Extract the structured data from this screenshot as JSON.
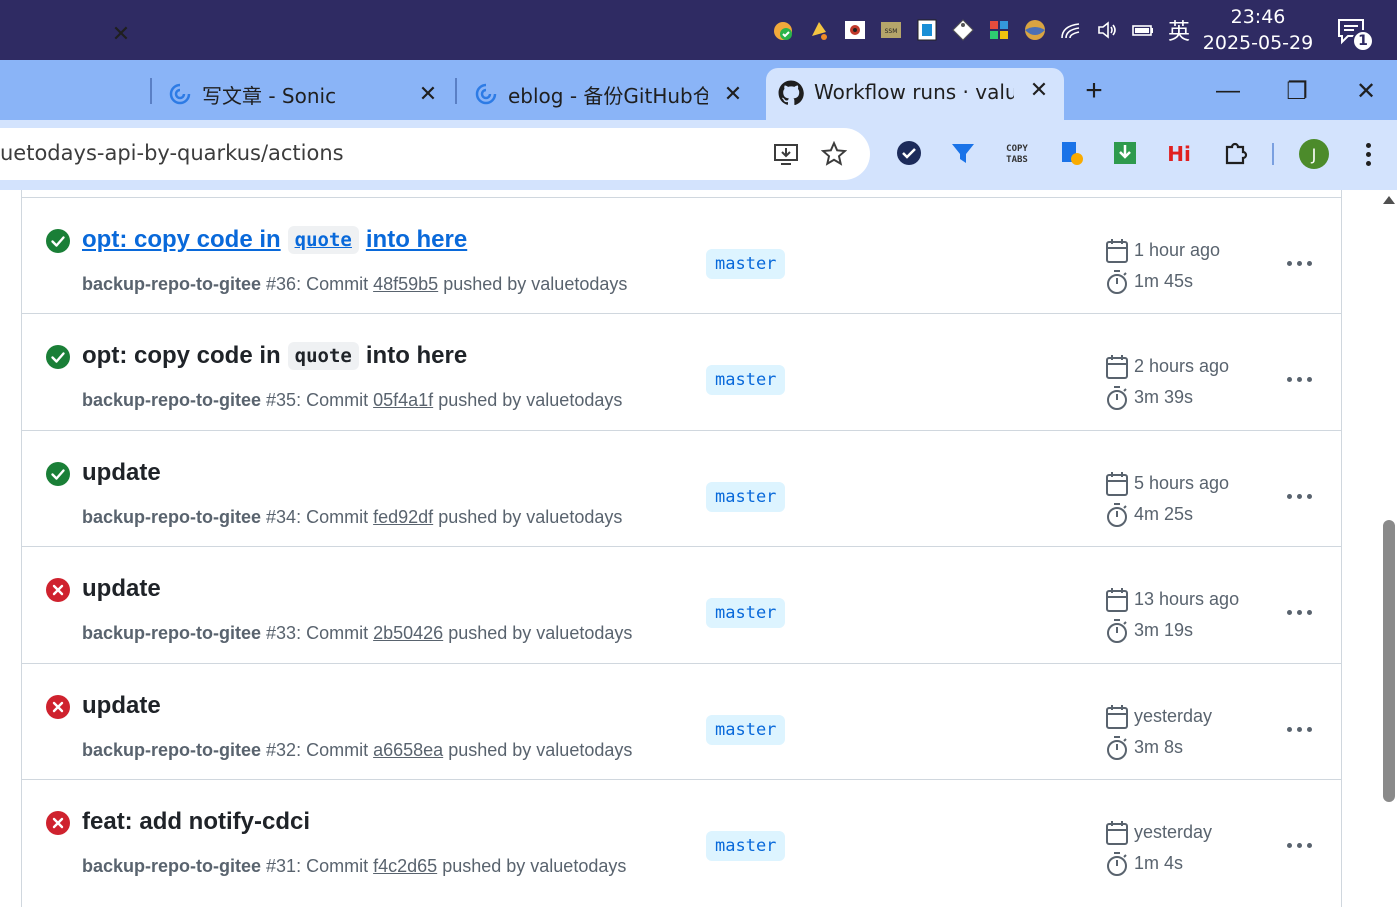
{
  "taskbar": {
    "ime": "英",
    "time": "23:46",
    "date": "2025-05-29",
    "notification_count": "1"
  },
  "tabs": [
    {
      "title": "",
      "close": "✕"
    },
    {
      "title": "写文章 - Sonic",
      "close": "✕"
    },
    {
      "title": "eblog - 备份GitHub仓库",
      "close": "✕"
    },
    {
      "title": "Workflow runs · valuetc",
      "close": "✕"
    }
  ],
  "new_tab": "+",
  "window_controls": {
    "minimize": "—",
    "restore": "❐",
    "close": "✕"
  },
  "toolbar": {
    "url": "uetodays-api-by-quarkus/actions",
    "avatar_letter": "J"
  },
  "runs": [
    {
      "status": "success",
      "title_prefix": "opt: copy code in",
      "title_code": "quote",
      "title_suffix": "into here",
      "workflow": "backup-repo-to-gitee",
      "number": "#36",
      "commit": "48f59b5",
      "actor": "valuetodays",
      "branch": "master",
      "time_ago": "1 hour ago",
      "duration": "1m 45s"
    },
    {
      "status": "success",
      "title_prefix": "opt: copy code in",
      "title_code": "quote",
      "title_suffix": "into here",
      "workflow": "backup-repo-to-gitee",
      "number": "#35",
      "commit": "05f4a1f",
      "actor": "valuetodays",
      "branch": "master",
      "time_ago": "2 hours ago",
      "duration": "3m 39s"
    },
    {
      "status": "success",
      "title_prefix": "update",
      "workflow": "backup-repo-to-gitee",
      "number": "#34",
      "commit": "fed92df",
      "actor": "valuetodays",
      "branch": "master",
      "time_ago": "5 hours ago",
      "duration": "4m 25s"
    },
    {
      "status": "failure",
      "title_prefix": "update",
      "workflow": "backup-repo-to-gitee",
      "number": "#33",
      "commit": "2b50426",
      "actor": "valuetodays",
      "branch": "master",
      "time_ago": "13 hours ago",
      "duration": "3m 19s"
    },
    {
      "status": "failure",
      "title_prefix": "update",
      "workflow": "backup-repo-to-gitee",
      "number": "#32",
      "commit": "a6658ea",
      "actor": "valuetodays",
      "branch": "master",
      "time_ago": "yesterday",
      "duration": "3m 8s"
    },
    {
      "status": "failure",
      "title_prefix": "feat: add notify-cdci",
      "workflow": "backup-repo-to-gitee",
      "number": "#31",
      "commit": "f4c2d65",
      "actor": "valuetodays",
      "branch": "master",
      "time_ago": "yesterday",
      "duration": "1m 4s"
    }
  ],
  "labels": {
    "commit_word": "Commit",
    "pushed_by": "pushed by"
  },
  "colors": {
    "success": "#1a7f37",
    "failure": "#cf222e",
    "link": "#0969da",
    "taskbar": "#2f2b63",
    "tabstrip": "#8ab4f7",
    "toolbar": "#d3e3fd"
  }
}
